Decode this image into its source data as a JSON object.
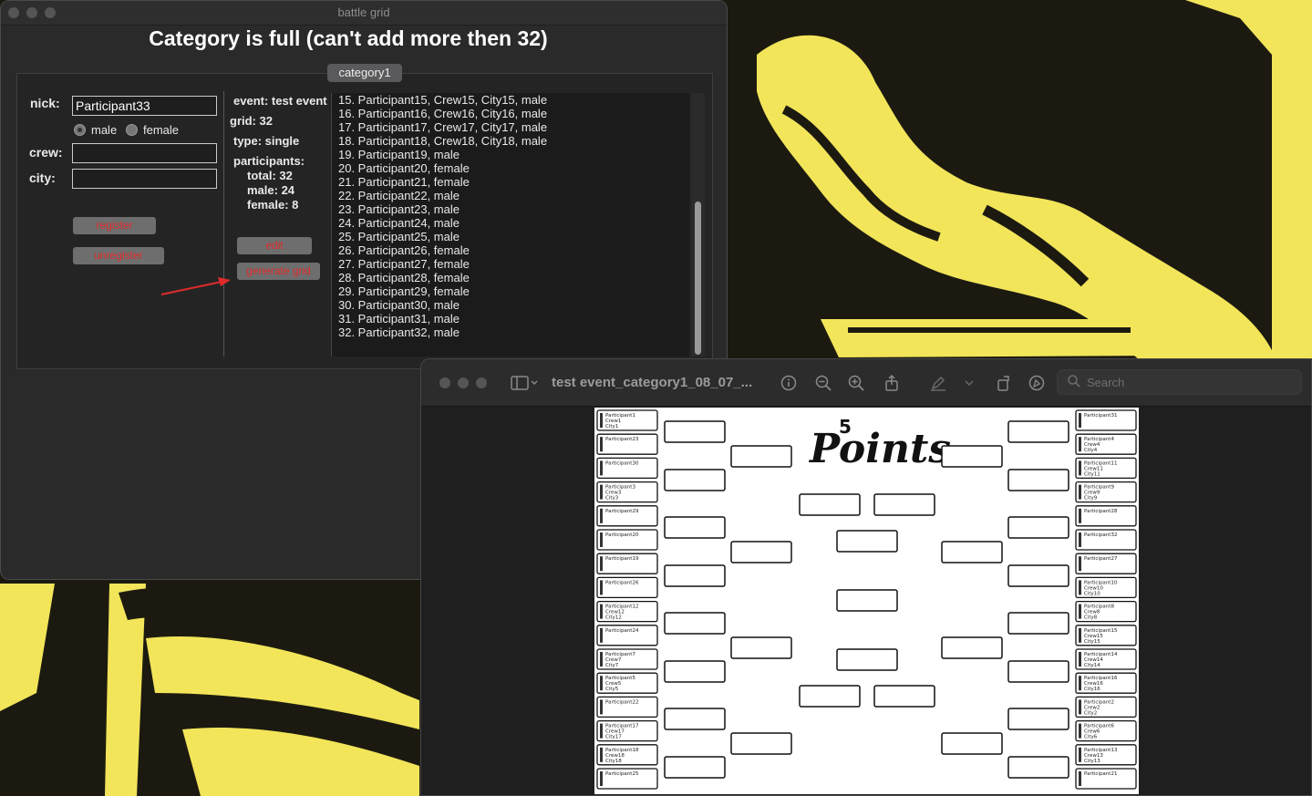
{
  "battle_window": {
    "title": "battle grid",
    "headline": "Category is full (can't add more then 32)",
    "tab": "category1",
    "form": {
      "nick_label": "nick:",
      "nick_value": "Participant33",
      "gender_male": "male",
      "gender_female": "female",
      "crew_label": "crew:",
      "crew_value": "",
      "city_label": "city:",
      "city_value": ""
    },
    "buttons": {
      "register": "register",
      "unregister": "unregister",
      "edit": "edit",
      "generate_grid": "generate grid"
    },
    "info": {
      "event": "event: test event",
      "grid": "grid: 32",
      "type": "type: single",
      "participants": "participants:",
      "total": "total: 32",
      "male": "male: 24",
      "female": "female: 8"
    },
    "participants_list": [
      "15. Participant15, Crew15, City15, male",
      "16. Participant16, Crew16, City16, male",
      "17. Participant17, Crew17, City17, male",
      "18. Participant18, Crew18, City18, male",
      "19. Participant19, male",
      "20. Participant20, female",
      "21. Participant21, female",
      "22. Participant22, male",
      "23. Participant23, male",
      "24. Participant24, male",
      "25. Participant25, male",
      "26. Participant26, female",
      "27. Participant27, female",
      "28. Participant28, female",
      "29. Participant29, female",
      "30. Participant30, male",
      "31. Participant31, male",
      "32. Participant32, male"
    ]
  },
  "preview_window": {
    "title": "test event_category1_08_07_...",
    "search_placeholder": "Search",
    "icons": [
      "sidebar-icon",
      "info-icon",
      "zoom-out-icon",
      "zoom-in-icon",
      "share-icon",
      "highlight-icon",
      "rotate-icon",
      "markup-icon",
      "search-icon"
    ],
    "logo_text": "Points",
    "logo_number": "5",
    "left_entries": [
      {
        "name": "Participant1",
        "crew": "Crew1",
        "city": "City1"
      },
      {
        "name": "Participant23",
        "crew": "",
        "city": ""
      },
      {
        "name": "Participant30",
        "crew": "",
        "city": ""
      },
      {
        "name": "Participant3",
        "crew": "Crew3",
        "city": "City3"
      },
      {
        "name": "Participant29",
        "crew": "",
        "city": ""
      },
      {
        "name": "Participant20",
        "crew": "",
        "city": ""
      },
      {
        "name": "Participant19",
        "crew": "",
        "city": ""
      },
      {
        "name": "Participant26",
        "crew": "",
        "city": ""
      },
      {
        "name": "Participant12",
        "crew": "Crew12",
        "city": "City12"
      },
      {
        "name": "Participant24",
        "crew": "",
        "city": ""
      },
      {
        "name": "Participant7",
        "crew": "Crew7",
        "city": "City7"
      },
      {
        "name": "Participant5",
        "crew": "Crew5",
        "city": "City5"
      },
      {
        "name": "Participant22",
        "crew": "",
        "city": ""
      },
      {
        "name": "Participant17",
        "crew": "Crew17",
        "city": "City17"
      },
      {
        "name": "Participant18",
        "crew": "Crew18",
        "city": "City18"
      },
      {
        "name": "Participant25",
        "crew": "",
        "city": ""
      }
    ],
    "right_entries": [
      {
        "name": "Participant31",
        "crew": "",
        "city": ""
      },
      {
        "name": "Participant4",
        "crew": "Crew4",
        "city": "City4"
      },
      {
        "name": "Participant11",
        "crew": "Crew11",
        "city": "City11"
      },
      {
        "name": "Participant9",
        "crew": "Crew9",
        "city": "City9"
      },
      {
        "name": "Participant28",
        "crew": "",
        "city": ""
      },
      {
        "name": "Participant32",
        "crew": "",
        "city": ""
      },
      {
        "name": "Participant27",
        "crew": "",
        "city": ""
      },
      {
        "name": "Participant10",
        "crew": "Crew10",
        "city": "City10"
      },
      {
        "name": "Participant8",
        "crew": "Crew8",
        "city": "City8"
      },
      {
        "name": "Participant15",
        "crew": "Crew15",
        "city": "City15"
      },
      {
        "name": "Participant14",
        "crew": "Crew14",
        "city": "City14"
      },
      {
        "name": "Participant16",
        "crew": "Crew16",
        "city": "City16"
      },
      {
        "name": "Participant2",
        "crew": "Crew2",
        "city": "City2"
      },
      {
        "name": "Participant6",
        "crew": "Crew6",
        "city": "City6"
      },
      {
        "name": "Participant13",
        "crew": "Crew13",
        "city": "City13"
      },
      {
        "name": "Participant21",
        "crew": "",
        "city": ""
      }
    ]
  },
  "colors": {
    "wallpaper_yellow": "#f2e55a",
    "wallpaper_dark": "#1c1a10",
    "button_text": "#e02b2b",
    "arrow": "#e02b2b"
  }
}
